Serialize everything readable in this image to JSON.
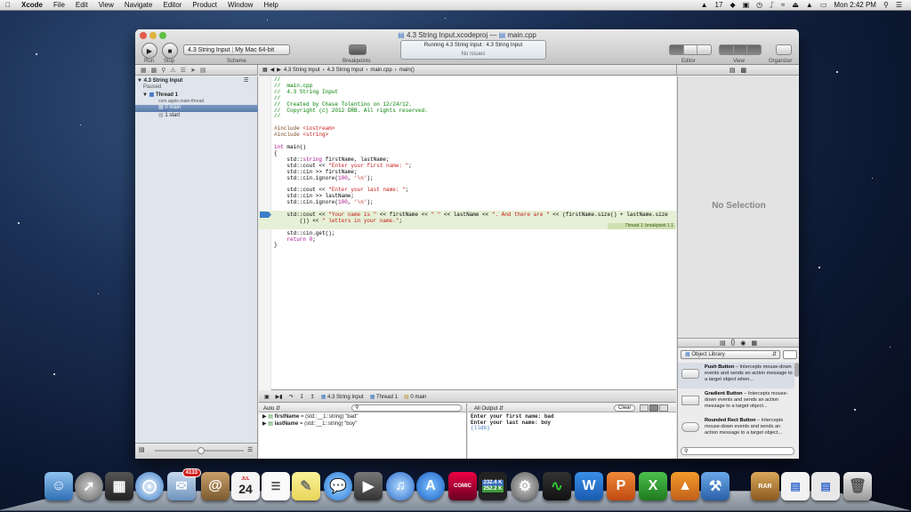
{
  "menubar": {
    "items": [
      "Xcode",
      "File",
      "Edit",
      "View",
      "Navigate",
      "Editor",
      "Product",
      "Window",
      "Help"
    ],
    "clock": "Mon 2:42 PM",
    "badge_count": "17"
  },
  "window": {
    "title_project": "4.3 String Input.xcodeproj",
    "title_sep": "—",
    "title_file": "main.cpp"
  },
  "toolbar": {
    "run_label": "Run",
    "stop_label": "Stop",
    "scheme_label": "Scheme",
    "scheme_value": "4.3 String Input",
    "scheme_dest": "My Mac 64-bit",
    "breakpoints_label": "Breakpoints",
    "activity_status": "Running 4.3 String Input : 4.3 String Input",
    "activity_issues": "No Issues",
    "editor_label": "Editor",
    "view_label": "View",
    "organizer_label": "Organizer"
  },
  "jumpbar": {
    "crumbs": [
      "4.3 String Input",
      "4.3 String Input",
      "main.cpp",
      "main()"
    ]
  },
  "navigator": {
    "target": "4.3 String Input",
    "target_status": "Paused",
    "thread": "Thread 1",
    "thread_queue": "com.apple.main-thread",
    "frames": [
      "0 main",
      "1 start"
    ]
  },
  "code": {
    "breakpoint_label": "Thread 1: breakpoint 1.1"
  },
  "debugbar": {
    "crumbs": [
      "4.3 String Input",
      "Thread 1",
      "0 main"
    ]
  },
  "variables": {
    "scope": "Auto",
    "items": [
      {
        "name": "firstName",
        "value": "= (std::__1::string) \"bad\""
      },
      {
        "name": "lastName",
        "value": "= (std::__1::string) \"boy\""
      }
    ]
  },
  "console": {
    "scope": "All Output",
    "clear_label": "Clear",
    "lines": [
      "Enter your first name: bad",
      "Enter your last name: boy",
      "(lldb)"
    ]
  },
  "inspector": {
    "empty_text": "No Selection"
  },
  "library": {
    "selector": "Object Library",
    "items": [
      {
        "title": "Push Button",
        "desc": " – Intercepts mouse-down events and sends an action message to a target object when..."
      },
      {
        "title": "Gradient Button",
        "desc": " – Intercepts mouse-down events and sends an action message to a target object..."
      },
      {
        "title": "Rounded Rect Button",
        "desc": " – Intercepts mouse-down events and sends an action message to a target object..."
      }
    ]
  },
  "dock": {
    "mail_badge": "4133",
    "calendar_day": "24",
    "calendar_month": "JUL",
    "net_up": "232.4 K",
    "net_down": "252.2 K",
    "comic_label": "COMIC"
  }
}
